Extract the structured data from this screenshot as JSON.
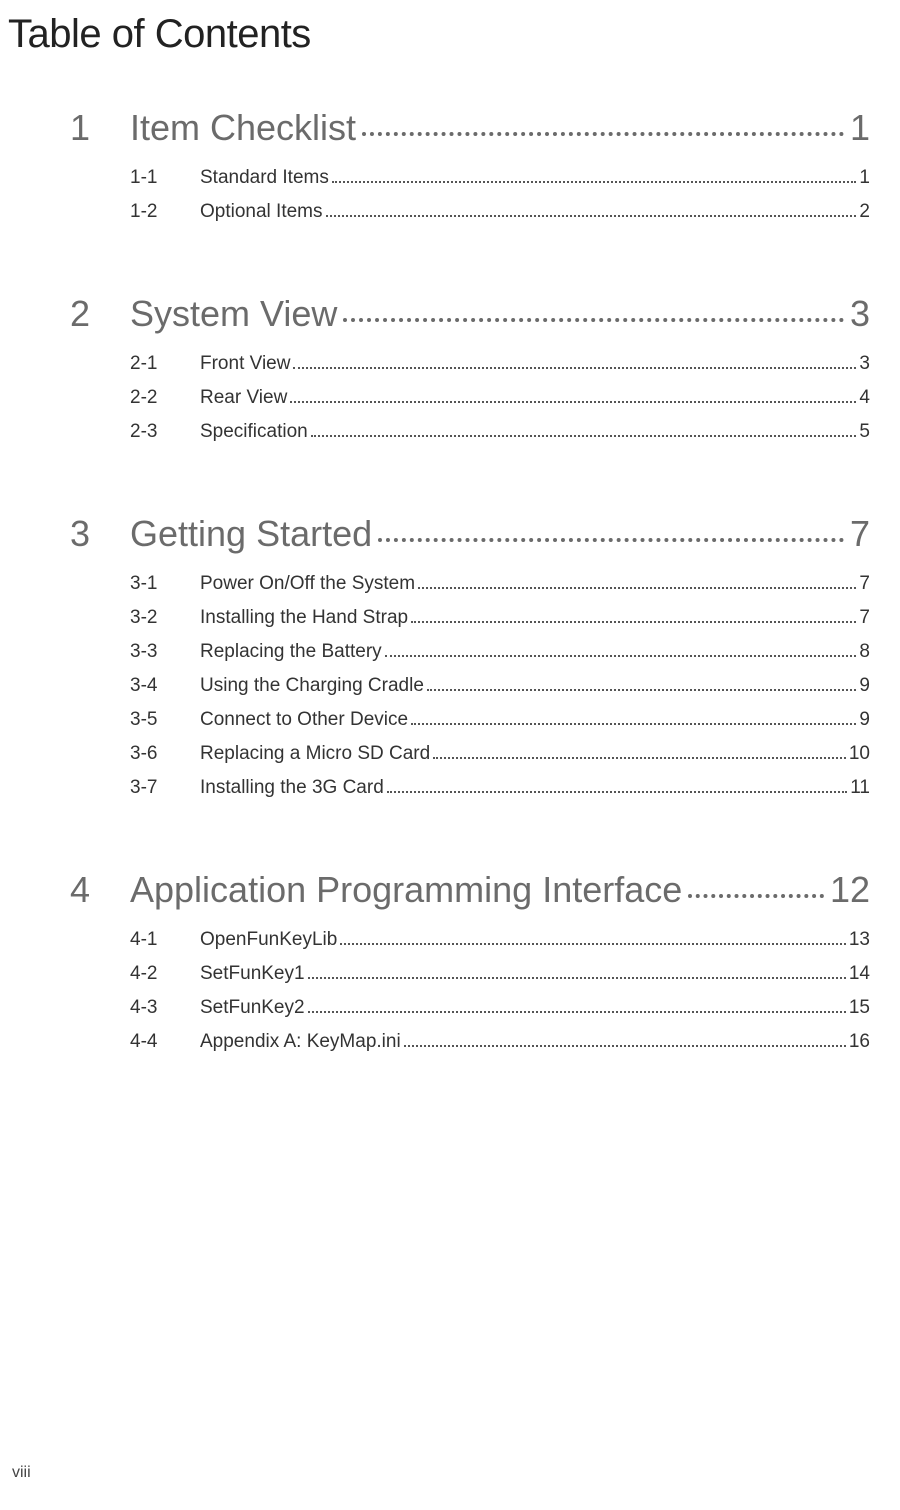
{
  "title": "Table of Contents",
  "footer_page": "viii",
  "chapters": [
    {
      "num": "1",
      "title": "Item Checklist",
      "page": "1",
      "subs": [
        {
          "num": "1-1",
          "title": "Standard Items",
          "page": "1"
        },
        {
          "num": "1-2",
          "title": "Optional Items",
          "page": "2"
        }
      ]
    },
    {
      "num": "2",
      "title": "System View",
      "page": "3",
      "subs": [
        {
          "num": "2-1",
          "title": "Front View",
          "page": "3"
        },
        {
          "num": "2-2",
          "title": "Rear View",
          "page": "4"
        },
        {
          "num": "2-3",
          "title": "Specification",
          "page": "5"
        }
      ]
    },
    {
      "num": "3",
      "title": "Getting Started",
      "page": "7",
      "subs": [
        {
          "num": "3-1",
          "title": "Power On/Off the System",
          "page": "7"
        },
        {
          "num": "3-2",
          "title": "Installing the Hand Strap",
          "page": "7"
        },
        {
          "num": "3-3",
          "title": "Replacing the Battery",
          "page": "8"
        },
        {
          "num": "3-4",
          "title": "Using the Charging Cradle",
          "page": "9"
        },
        {
          "num": "3-5",
          "title": "Connect to Other Device",
          "page": "9"
        },
        {
          "num": "3-6",
          "title": "Replacing a Micro SD Card",
          "page": "10"
        },
        {
          "num": "3-7",
          "title": "Installing the 3G Card",
          "page": "11"
        }
      ]
    },
    {
      "num": "4",
      "title": "Application Programming Interface",
      "page": "12",
      "subs": [
        {
          "num": "4-1",
          "title": "OpenFunKeyLib",
          "page": "13"
        },
        {
          "num": "4-2",
          "title": "SetFunKey1",
          "page": "14"
        },
        {
          "num": "4-3",
          "title": "SetFunKey2",
          "page": "15"
        },
        {
          "num": "4-4",
          "title": "Appendix A: KeyMap.ini",
          "page": "16"
        }
      ]
    }
  ]
}
